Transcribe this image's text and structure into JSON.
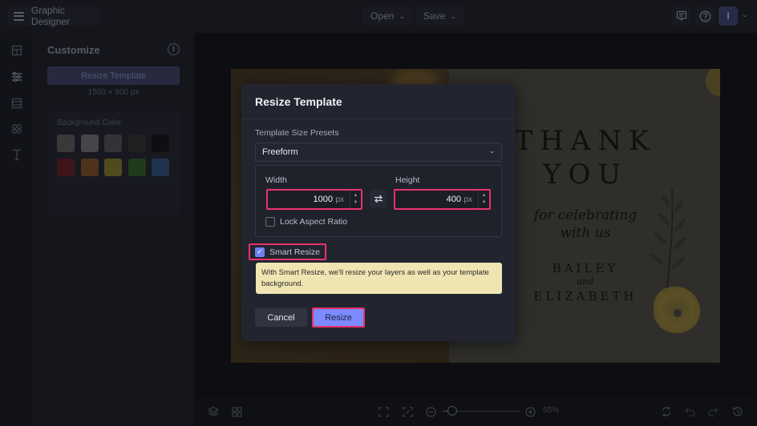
{
  "header": {
    "app_title": "Graphic Designer",
    "menu_icon": "hamburger-icon",
    "open_label": "Open",
    "save_label": "Save",
    "feedback_icon": "feedback-icon",
    "help_icon": "help-icon",
    "avatar_initial": "I"
  },
  "rail": {
    "items": [
      {
        "icon": "template-icon"
      },
      {
        "icon": "sliders-icon",
        "active": true
      },
      {
        "icon": "layout-icon"
      },
      {
        "icon": "elements-icon"
      },
      {
        "icon": "text-icon"
      }
    ]
  },
  "customize": {
    "title": "Customize",
    "resize_button": "Resize Template",
    "size_text": "1500 × 900 px",
    "background_color_label": "Background Color",
    "swatches": [
      "#6e6862",
      "#8a8a8a",
      "#595959",
      "#2e2a28",
      "#000000",
      "#7a0f16",
      "#9a5a10",
      "#a6951a",
      "#2f6a18",
      "#2a5a93"
    ]
  },
  "canvas": {
    "card": {
      "line1": "THANK",
      "line2": "YOU",
      "script1": "for celebrating",
      "script2": "with us",
      "name1": "BAILEY",
      "and": "and",
      "name2": "ELIZABETH"
    }
  },
  "dialog": {
    "title": "Resize Template",
    "presets_label": "Template Size Presets",
    "presets_value": "Freeform",
    "width_label": "Width",
    "width_value": "1000",
    "height_label": "Height",
    "height_value": "400",
    "unit": "px",
    "lock_label": "Lock Aspect Ratio",
    "lock_checked": false,
    "smart_resize_label": "Smart Resize",
    "smart_resize_checked": true,
    "notice": "With Smart Resize, we'll resize your layers as well as your template background.",
    "cancel_label": "Cancel",
    "resize_label": "Resize",
    "highlight_color": "#e8326b",
    "accent_color": "#7b8bff"
  },
  "bottom": {
    "zoom_percent": "55%",
    "zoom_level": 0.55
  }
}
